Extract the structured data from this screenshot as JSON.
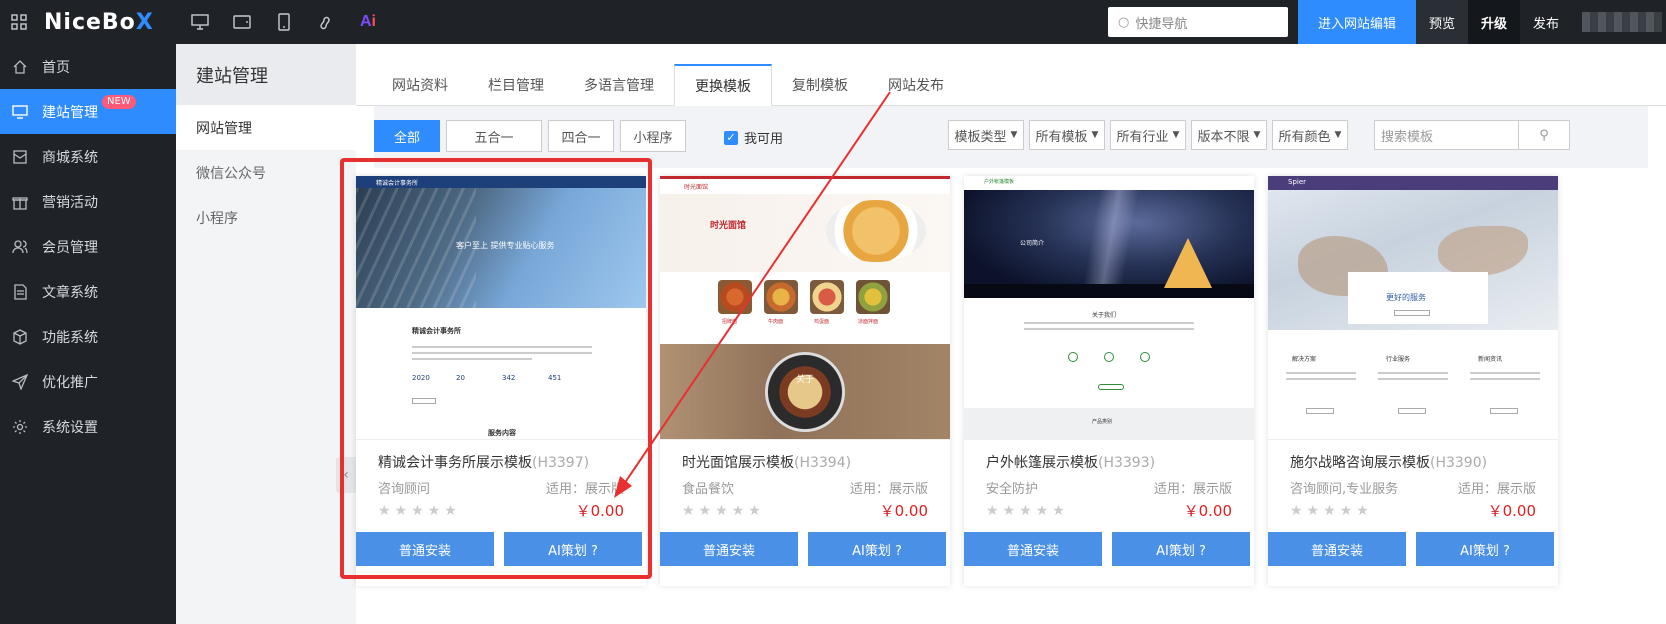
{
  "topbar": {
    "logo_main": "NiceBo",
    "logo_x": "X",
    "ai_label_a": "A",
    "ai_label_i": "i",
    "search_placeholder": "快捷导航",
    "edit_button": "进入网站编辑",
    "preview_button": "预览",
    "upgrade_button": "升级",
    "publish_button": "发布"
  },
  "sidebar": {
    "items": [
      {
        "label": "首页",
        "icon": "home-icon"
      },
      {
        "label": "建站管理",
        "icon": "monitor-icon",
        "badge": "NEW",
        "active": true
      },
      {
        "label": "商城系统",
        "icon": "mail-icon"
      },
      {
        "label": "营销活动",
        "icon": "gift-icon"
      },
      {
        "label": "会员管理",
        "icon": "users-icon"
      },
      {
        "label": "文章系统",
        "icon": "document-icon"
      },
      {
        "label": "功能系统",
        "icon": "cube-icon"
      },
      {
        "label": "优化推广",
        "icon": "send-icon"
      },
      {
        "label": "系统设置",
        "icon": "gear-icon"
      }
    ]
  },
  "subnav": {
    "title": "建站管理",
    "items": [
      "网站管理",
      "微信公众号",
      "小程序"
    ]
  },
  "tabs": [
    "网站资料",
    "栏目管理",
    "多语言管理",
    "更换模板",
    "复制模板",
    "网站发布"
  ],
  "filters": {
    "buttons": [
      "全部",
      "五合一",
      "四合一",
      "小程序"
    ],
    "checkbox_label": "我可用",
    "dropdowns": [
      "模板类型",
      "所有模板",
      "所有行业",
      "版本不限",
      "所有颜色"
    ],
    "search_placeholder": "搜索模板"
  },
  "cards": [
    {
      "name": "精诚会计事务所展示模板",
      "code": "(H3397)",
      "category": "咨询顾问",
      "apply": "适用：展示版",
      "price": "￥0.00",
      "install": "普通安装",
      "ai": "AI策划 ?",
      "thumb": {
        "brand": "精诚会计事务所",
        "hero": "客户至上 提供专业贴心服务",
        "about": "精诚会计事务所",
        "stats": [
          "2020",
          "20",
          "342",
          "451"
        ],
        "service": "服务内容"
      }
    },
    {
      "name": "时光面馆展示模板",
      "code": "(H3394)",
      "category": "食品餐饮",
      "apply": "适用：展示版",
      "price": "￥0.00",
      "install": "普通安装",
      "ai": "AI策划 ?",
      "thumb": {
        "brand": "时光面馆",
        "hero": "时光面馆",
        "dishes": [
          "招牌面",
          "牛肉面",
          "鸡蛋面",
          "凉面拌面"
        ],
        "about": "关于"
      }
    },
    {
      "name": "户外帐篷展示模板",
      "code": "(H3393)",
      "category": "安全防护",
      "apply": "适用：展示版",
      "price": "￥0.00",
      "install": "普通安装",
      "ai": "AI策划 ?",
      "thumb": {
        "brand": "户外帐篷模板",
        "hero": "公司简介",
        "about": "关于我们",
        "products": "产品类别"
      }
    },
    {
      "name": "施尔战略咨询展示模板",
      "code": "(H3390)",
      "category": "咨询顾问,专业服务",
      "apply": "适用：展示版",
      "price": "￥0.00",
      "install": "普通安装",
      "ai": "AI策划 ?",
      "thumb": {
        "brand": "Spier",
        "hero": "更好的服务",
        "cols": [
          "解决方案",
          "行业服务",
          "新闻资讯"
        ]
      }
    }
  ]
}
